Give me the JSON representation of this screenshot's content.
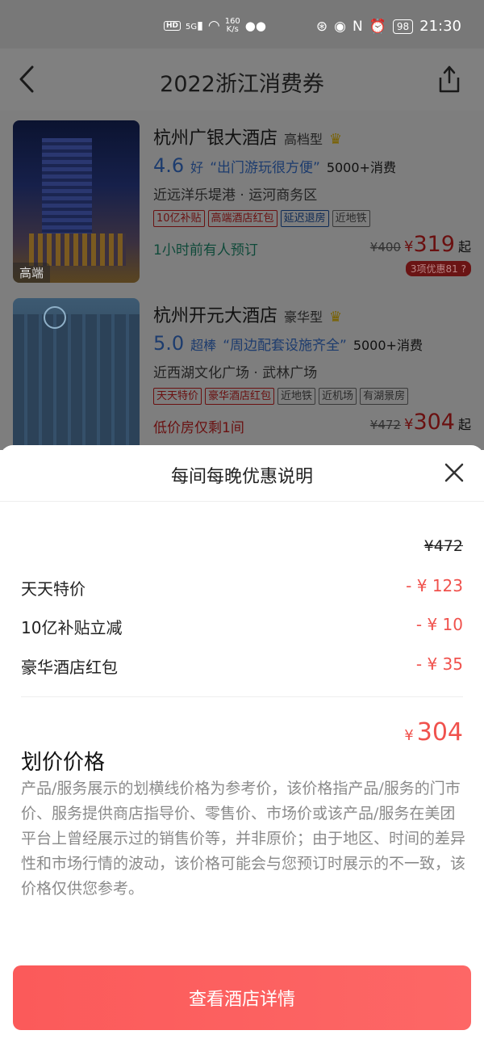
{
  "status_bar": {
    "hd": "HD",
    "signal": "5G",
    "net_speed_value": "160",
    "net_speed_unit": "K/s",
    "battery": "98",
    "time": "21:30"
  },
  "nav": {
    "title": "2022浙江消费券"
  },
  "hotels": [
    {
      "name": "杭州广银大酒店",
      "type": "高档型",
      "score": "4.6",
      "score_word": "好",
      "quote": "“出门游玩很方便”",
      "consumption": "5000+消费",
      "location": "近远洋乐堤港 · 运河商务区",
      "chips": [
        {
          "label": "10亿补贴",
          "style": "red"
        },
        {
          "label": "高端酒店红包",
          "style": "red"
        },
        {
          "label": "延迟退房",
          "style": "blue"
        },
        {
          "label": "近地铁",
          "style": "grey"
        }
      ],
      "note": "1小时前有人预订",
      "orig_price": "¥400",
      "price_yen": "¥",
      "price": "319",
      "price_suffix": "起",
      "promo": "3项优惠81",
      "thumb_tag": "高端"
    },
    {
      "name": "杭州开元大酒店",
      "type": "豪华型",
      "score": "5.0",
      "score_word": "超棒",
      "quote": "“周边配套设施齐全”",
      "consumption": "5000+消费",
      "location": "近西湖文化广场 · 武林广场",
      "chips": [
        {
          "label": "天天特价",
          "style": "red"
        },
        {
          "label": "豪华酒店红包",
          "style": "red"
        },
        {
          "label": "近地铁",
          "style": "grey"
        },
        {
          "label": "近机场",
          "style": "grey"
        },
        {
          "label": "有湖景房",
          "style": "grey"
        }
      ],
      "note": "低价房仅剩1间",
      "orig_price": "¥472",
      "price_yen": "¥",
      "price": "304",
      "price_suffix": "起"
    }
  ],
  "sheet": {
    "title": "每间每晚优惠说明",
    "original_price": "¥472",
    "discounts": [
      {
        "label": "天天特价",
        "amount": "- ¥ 123"
      },
      {
        "label": "10亿补贴立减",
        "amount": "- ¥ 10"
      },
      {
        "label": "豪华酒店红包",
        "amount": "- ¥ 35"
      }
    ],
    "final_yen": "¥",
    "final_price": "304",
    "strike_title": "划价价格",
    "strike_desc": "产品/服务展示的划横线价格为参考价，该价格指产品/服务的门市价、服务提供商店指导价、零售价、市场价或该产品/服务在美团平台上曾经展示过的销售价等，并非原价；由于地区、时间的差异性和市场行情的波动，该价格可能会与您预订时展示的不一致，该价格仅供您参考。",
    "button_label": "查看酒店详情"
  },
  "colors": {
    "accent_red": "#f0524d",
    "button_red": "#fb5a5a",
    "overlay_grey": "#7e7e7e"
  }
}
